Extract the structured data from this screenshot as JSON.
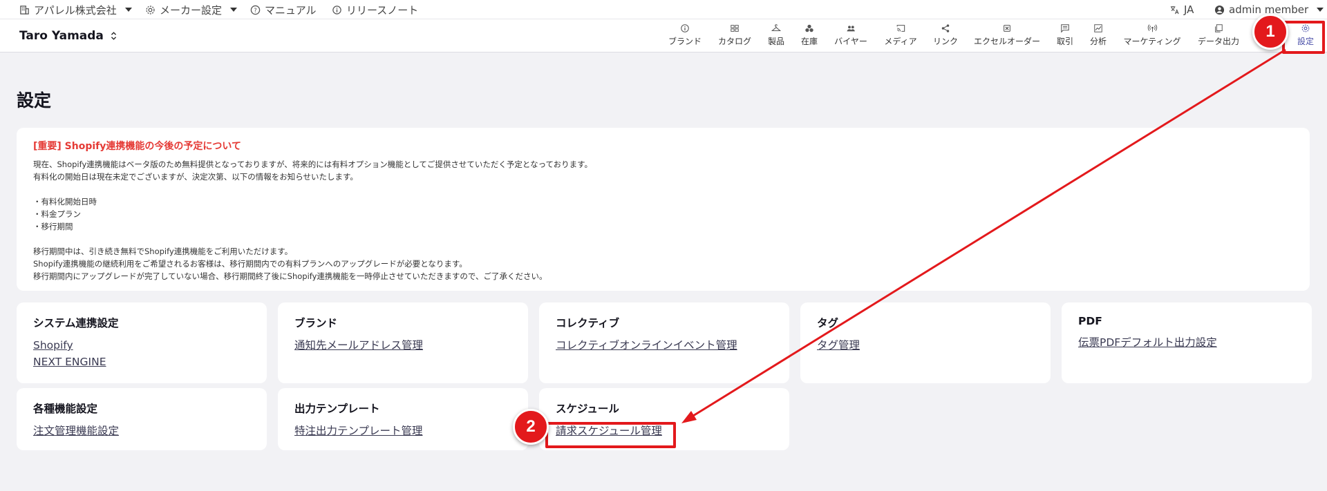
{
  "topbar": {
    "company": "アパレル株式会社",
    "maker_settings": "メーカー設定",
    "manual": "マニュアル",
    "release_notes": "リリースノート",
    "language": "JA",
    "user": "admin member"
  },
  "navbar": {
    "account_name": "Taro Yamada",
    "items": [
      {
        "label": "ブランド",
        "icon": "info-icon"
      },
      {
        "label": "カタログ",
        "icon": "catalog-icon"
      },
      {
        "label": "製品",
        "icon": "hanger-icon"
      },
      {
        "label": "在庫",
        "icon": "boxes-icon"
      },
      {
        "label": "バイヤー",
        "icon": "users-icon"
      },
      {
        "label": "メディア",
        "icon": "cast-icon"
      },
      {
        "label": "リンク",
        "icon": "share-icon"
      },
      {
        "label": "エクセルオーダー",
        "icon": "excel-icon"
      },
      {
        "label": "取引",
        "icon": "message-icon"
      },
      {
        "label": "分析",
        "icon": "chart-icon"
      },
      {
        "label": "マーケティング",
        "icon": "broadcast-icon"
      },
      {
        "label": "データ出力",
        "icon": "copy-icon"
      },
      {
        "label": "設定",
        "icon": "gear-icon"
      }
    ]
  },
  "page": {
    "title": "設定"
  },
  "notice": {
    "title": "[重要] Shopify連携機能の今後の予定について",
    "lines": [
      "現在、Shopify連携機能はベータ版のため無料提供となっておりますが、将来的には有料オプション機能としてご提供させていただく予定となっております。",
      "有料化の開始日は現在未定でございますが、決定次第、以下の情報をお知らせいたします。",
      "",
      "・有料化開始日時",
      "・料金プラン",
      "・移行期間",
      "",
      "移行期間中は、引き続き無料でShopify連携機能をご利用いただけます。",
      "Shopify連携機能の継続利用をご希望されるお客様は、移行期間内での有料プランへのアップグレードが必要となります。",
      "移行期間内にアップグレードが完了していない場合、移行期間終了後にShopify連携機能を一時停止させていただきますので、ご了承ください。"
    ]
  },
  "cards": [
    {
      "title": "システム連携設定",
      "links": [
        "Shopify",
        "NEXT ENGINE"
      ]
    },
    {
      "title": "ブランド",
      "links": [
        "通知先メールアドレス管理"
      ]
    },
    {
      "title": "コレクティブ",
      "links": [
        "コレクティブオンラインイベント管理"
      ]
    },
    {
      "title": "タグ",
      "links": [
        "タグ管理"
      ]
    },
    {
      "title": "PDF",
      "links": [
        "伝票PDFデフォルト出力設定"
      ]
    },
    {
      "title": "各種機能設定",
      "links": [
        "注文管理機能設定"
      ]
    },
    {
      "title": "出力テンプレート",
      "links": [
        "特注出力テンプレート管理"
      ]
    },
    {
      "title": "スケジュール",
      "links": [
        "請求スケジュール管理"
      ]
    }
  ],
  "annotations": {
    "step1": "1",
    "step2": "2",
    "color": "#e3191c"
  }
}
